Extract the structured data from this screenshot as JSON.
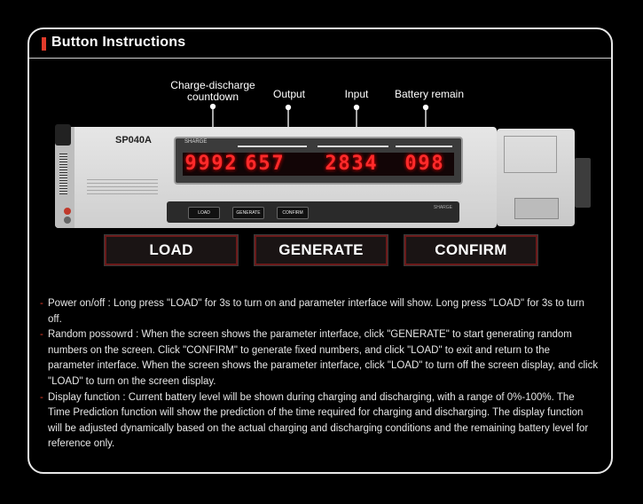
{
  "title": "Button Instructions",
  "callouts": {
    "countdown_line1": "Charge-discharge",
    "countdown_line2": "countdown",
    "output": "Output",
    "input": "Input",
    "battery": "Battery remain"
  },
  "device": {
    "model": "SP040A",
    "screen_tag": "SHARGE",
    "digits_countdown": [
      "9",
      "9",
      "9",
      "2"
    ],
    "digits_output": [
      "6",
      "5",
      "7"
    ],
    "digits_input": [
      "2",
      "8",
      "3",
      "4"
    ],
    "digits_battery": [
      "0",
      "9",
      "8"
    ],
    "mini_buttons": [
      "LOAD",
      "GENERATE",
      "CONFIRM"
    ],
    "brand": "SHARGE",
    "colors": {
      "digit": "#ff2a2a",
      "accent": "#e23b2a"
    }
  },
  "buttons": {
    "load": "LOAD",
    "generate": "GENERATE",
    "confirm": "CONFIRM"
  },
  "instructions": [
    "Power on/off : Long press \"LOAD\" for 3s to turn on and parameter interface will show. Long press \"LOAD\" for 3s to turn off.",
    "Random possowrd : When the screen shows the parameter interface, click \"GENERATE\" to start generating random numbers on the screen. Click \"CONFIRM\" to generate fixed numbers, and click \"LOAD\" to exit and return to the parameter interface. When the screen shows the parameter interface, click \"LOAD\" to turn off the screen display, and click \"LOAD\" to turn on the screen display.",
    "Display function : Current battery level will be shown during charging and discharging, with a range of 0%-100%. The Time Prediction function will show the prediction of the time required for charging and discharging. The display function will be adjusted dynamically based on the actual charging and discharging conditions and the remaining battery level for reference only."
  ]
}
